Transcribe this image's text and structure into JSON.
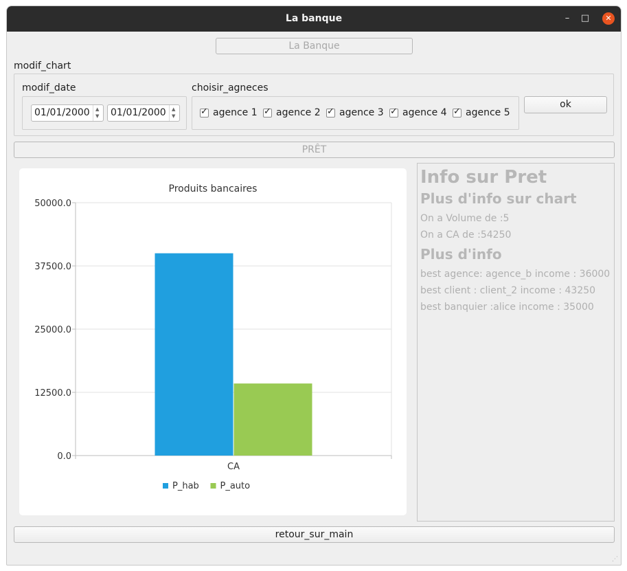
{
  "window": {
    "title": "La banque",
    "minimize_glyph": "–",
    "maximize_glyph": "□",
    "close_glyph": "✕"
  },
  "header": {
    "la_banque_button": "La Banque"
  },
  "modif_chart": {
    "label": "modif_chart",
    "modif_date": {
      "label": "modif_date",
      "date_from": "01/01/2000",
      "date_to": "01/01/2000"
    },
    "choisir_agneces": {
      "label": "choisir_agneces",
      "agencies": [
        {
          "label": "agence 1",
          "checked": true
        },
        {
          "label": "agence 2",
          "checked": true
        },
        {
          "label": "agence 3",
          "checked": true
        },
        {
          "label": "agence 4",
          "checked": true
        },
        {
          "label": "agence 5",
          "checked": true
        }
      ]
    },
    "ok_button": "ok"
  },
  "pret_button": "PRÊT",
  "chart_data": {
    "type": "bar",
    "title": "Produits bancaires",
    "categories": [
      "CA"
    ],
    "series": [
      {
        "name": "P_hab",
        "values": [
          40000
        ],
        "color": "#209fdf"
      },
      {
        "name": "P_auto",
        "values": [
          14250
        ],
        "color": "#99ca53"
      }
    ],
    "ylim": [
      0,
      50000
    ],
    "yticks": [
      "0.0",
      "12500.0",
      "25000.0",
      "37500.0",
      "50000.0"
    ],
    "grid": true,
    "legend": "bottom"
  },
  "info": {
    "title": "Info sur Pret",
    "chart_heading": "Plus d'info sur chart",
    "volume_text": "On a Volume de  :5",
    "ca_text": "On a CA de  :54250",
    "more_heading": "Plus d'info",
    "best_agence": "best agence: agence_b income  : 36000",
    "best_client": "best client : client_2 income  : 43250",
    "best_banquier": "best banquier :alice income  : 35000"
  },
  "footer": {
    "retour_button": "retour_sur_main"
  },
  "colors": {
    "titlebar": "#2c2c2c",
    "close": "#e95420",
    "window_bg": "#efefef"
  }
}
